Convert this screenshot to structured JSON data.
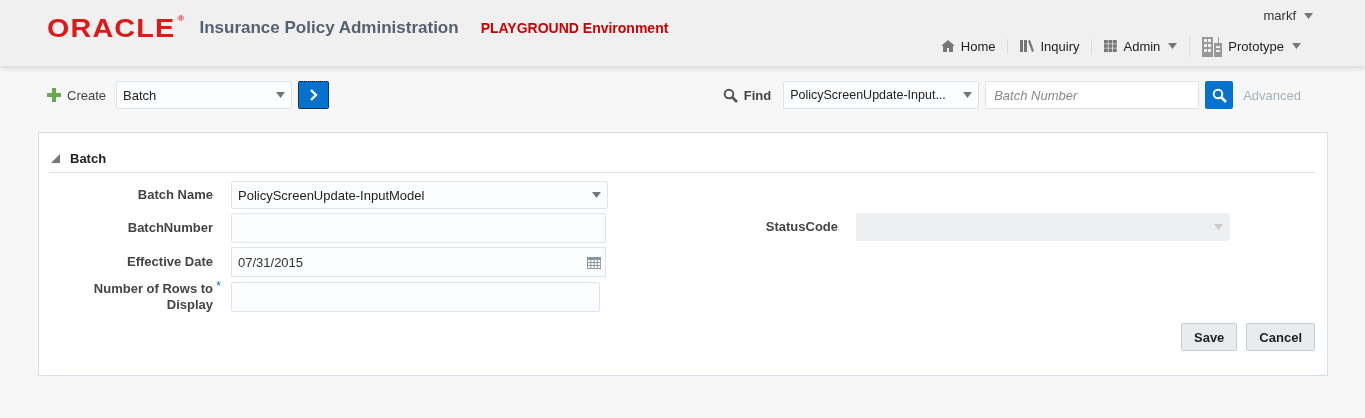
{
  "header": {
    "logo": "ORACLE",
    "logo_mark": "®",
    "title": "Insurance Policy Administration",
    "environment": "PLAYGROUND Environment",
    "user": "markf",
    "nav": [
      {
        "label": "Home",
        "dropdown": false
      },
      {
        "label": "Inquiry",
        "dropdown": false
      },
      {
        "label": "Admin",
        "dropdown": true
      },
      {
        "label": "Prototype",
        "dropdown": true
      }
    ]
  },
  "toolbar": {
    "create_label": "Create",
    "create_value": "Batch",
    "find_label": "Find",
    "find_value": "PolicyScreenUpdate-Input...",
    "search_placeholder": "Batch Number",
    "advanced": {
      "label": "Advanced",
      "disabled": true
    }
  },
  "panel": {
    "title": "Batch",
    "expanded": true,
    "left_fields": [
      {
        "label": "Batch Name",
        "kind": "select",
        "value": "PolicyScreenUpdate-InputModel"
      },
      {
        "label": "BatchNumber",
        "kind": "text"
      },
      {
        "label": "Effective Date",
        "kind": "date",
        "value": "07/31/2015"
      },
      {
        "label": "Number of Rows to Display",
        "kind": "text",
        "required_mark": "*"
      }
    ],
    "right_fields": [
      {
        "label": "StatusCode",
        "kind": "select",
        "disabled": true
      }
    ],
    "buttons": [
      "Save",
      "Cancel"
    ]
  }
}
